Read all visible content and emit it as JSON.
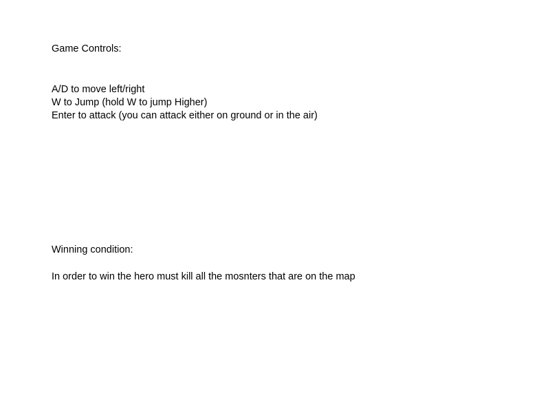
{
  "controls": {
    "heading": "Game Controls:",
    "lines": [
      "A/D to move left/right",
      "W to Jump (hold W to jump Higher)",
      "Enter to attack (you can attack either on ground or in the air)"
    ]
  },
  "winning": {
    "heading": "Winning condition:",
    "text": "In order to win the hero must kill all the mosnters that are on the map"
  }
}
